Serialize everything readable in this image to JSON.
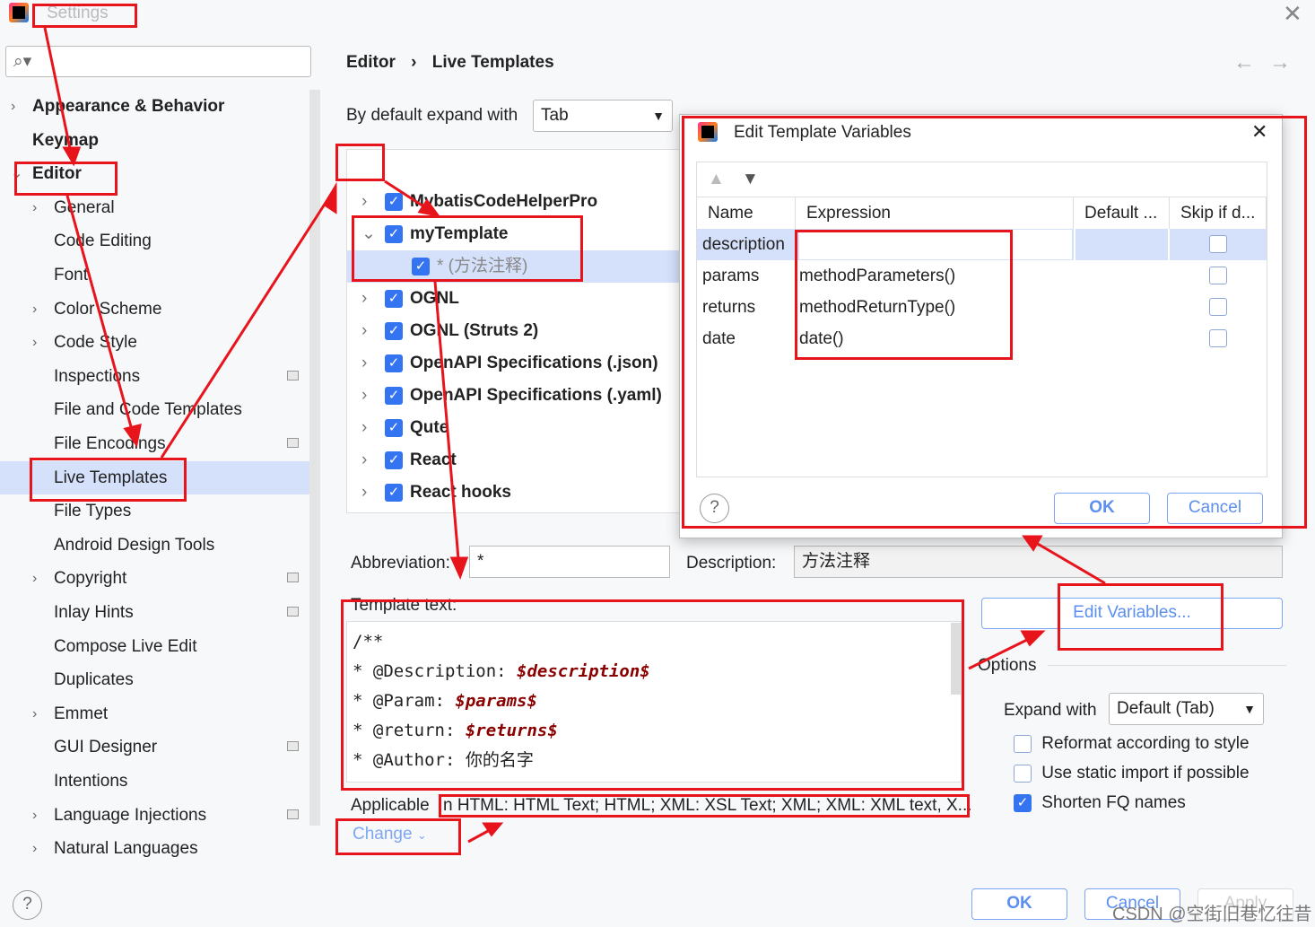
{
  "window": {
    "title": "Settings"
  },
  "sidebar": {
    "items": [
      {
        "label": "Appearance & Behavior",
        "bold": true,
        "chev": "right",
        "indent": 0
      },
      {
        "label": "Keymap",
        "bold": true,
        "indent": 0
      },
      {
        "label": "Editor",
        "bold": true,
        "chev": "down",
        "indent": 0
      },
      {
        "label": "General",
        "chev": "right",
        "indent": 1
      },
      {
        "label": "Code Editing",
        "indent": 1
      },
      {
        "label": "Font",
        "indent": 1
      },
      {
        "label": "Color Scheme",
        "chev": "right",
        "indent": 1
      },
      {
        "label": "Code Style",
        "chev": "right",
        "indent": 1
      },
      {
        "label": "Inspections",
        "indent": 1,
        "mark": true
      },
      {
        "label": "File and Code Templates",
        "indent": 1
      },
      {
        "label": "File Encodings",
        "indent": 1,
        "mark": true
      },
      {
        "label": "Live Templates",
        "indent": 1,
        "selected": true
      },
      {
        "label": "File Types",
        "indent": 1
      },
      {
        "label": "Android Design Tools",
        "indent": 1
      },
      {
        "label": "Copyright",
        "chev": "right",
        "indent": 1,
        "mark": true
      },
      {
        "label": "Inlay Hints",
        "indent": 1,
        "mark": true
      },
      {
        "label": "Compose Live Edit",
        "indent": 1
      },
      {
        "label": "Duplicates",
        "indent": 1
      },
      {
        "label": "Emmet",
        "chev": "right",
        "indent": 1
      },
      {
        "label": "GUI Designer",
        "indent": 1,
        "mark": true
      },
      {
        "label": "Intentions",
        "indent": 1
      },
      {
        "label": "Language Injections",
        "chev": "right",
        "indent": 1,
        "mark": true
      },
      {
        "label": "Natural Languages",
        "chev": "right",
        "indent": 1
      }
    ]
  },
  "breadcrumb": {
    "parent": "Editor",
    "sep": "›",
    "current": "Live Templates"
  },
  "expand": {
    "label": "By default expand with",
    "value": "Tab"
  },
  "tree": [
    {
      "label": "MybatisCodeHelperPro",
      "chev": "›"
    },
    {
      "label": "myTemplate",
      "chev": "⌄"
    },
    {
      "label": "* (方法注释)",
      "child": true
    },
    {
      "label": "OGNL",
      "chev": "›"
    },
    {
      "label": "OGNL (Struts 2)",
      "chev": "›"
    },
    {
      "label": "OpenAPI Specifications (.json)",
      "chev": "›"
    },
    {
      "label": "OpenAPI Specifications (.yaml)",
      "chev": "›"
    },
    {
      "label": "Qute",
      "chev": "›"
    },
    {
      "label": "React",
      "chev": "›"
    },
    {
      "label": "React hooks",
      "chev": "›"
    }
  ],
  "form": {
    "abbr_label": "Abbreviation:",
    "abbr_value": "*",
    "desc_label": "Description:",
    "desc_value": "方法注释",
    "template_label": "Template text:",
    "code": {
      "l1": "/**",
      "l2a": "* @Description: ",
      "l2b": "$description$",
      "l3a": "* @Param: ",
      "l3b": "$params$",
      "l4a": "* @return: ",
      "l4b": "$returns$",
      "l5a": "* @Author: ",
      "l5b": "你的名字"
    },
    "applicable_label": "Applicable",
    "applicable_value": "n HTML: HTML Text; HTML; XML: XSL Text; XML; XML: XML text, X...",
    "change": "Change"
  },
  "edit_vars_button": "Edit Variables...",
  "options": {
    "title": "Options",
    "expand_label": "Expand with",
    "expand_value": "Default (Tab)",
    "checks": [
      {
        "label": "Reformat according to style",
        "checked": false
      },
      {
        "label": "Use static import if possible",
        "checked": false
      },
      {
        "label": "Shorten FQ names",
        "checked": true
      }
    ]
  },
  "footer": {
    "ok": "OK",
    "cancel": "Cancel",
    "apply": "Apply",
    "watermark": "CSDN @空街旧巷忆往昔"
  },
  "dialog": {
    "title": "Edit Template Variables",
    "columns": [
      "Name",
      "Expression",
      "Default ...",
      "Skip if d..."
    ],
    "rows": [
      {
        "name": "description",
        "expr": "",
        "skip": false
      },
      {
        "name": "params",
        "expr": "methodParameters()",
        "skip": false
      },
      {
        "name": "returns",
        "expr": "methodReturnType()",
        "skip": false
      },
      {
        "name": "date",
        "expr": "date()",
        "skip": false
      }
    ],
    "ok": "OK",
    "cancel": "Cancel"
  },
  "colors": {
    "accent": "#3574f0",
    "annotation": "#e8141c",
    "selection": "#d5e1fb"
  }
}
